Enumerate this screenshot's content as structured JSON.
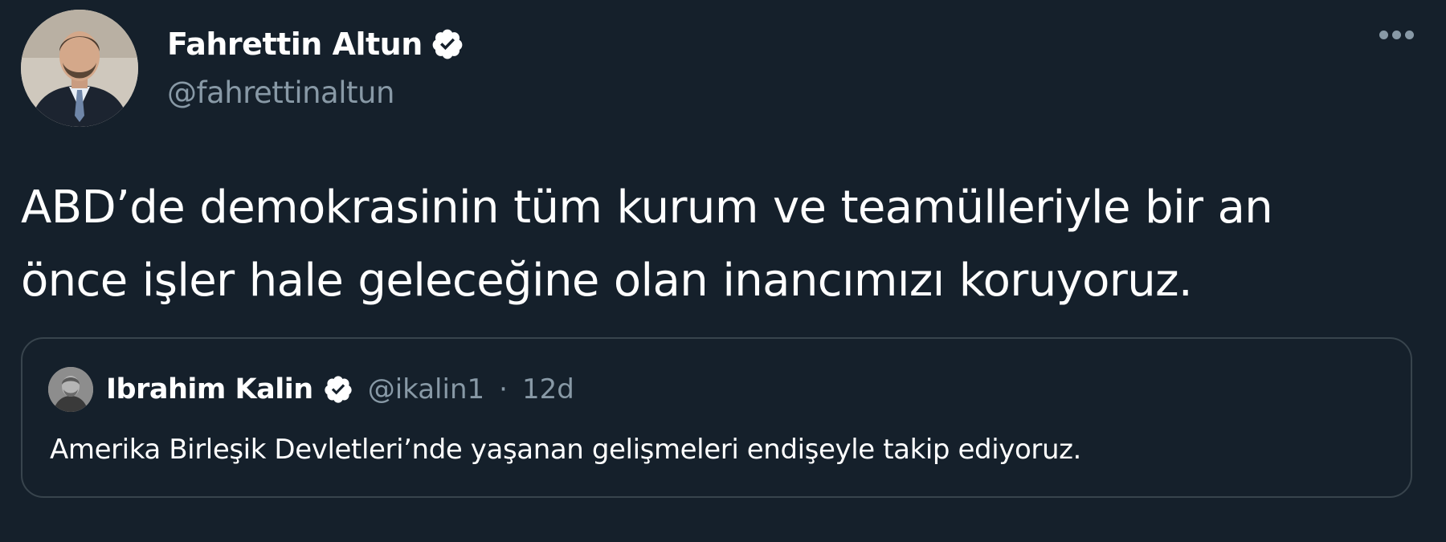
{
  "tweet": {
    "author_name": "Fahrettin Altun",
    "author_handle": "@fahrettinaltun",
    "author_verified": true,
    "text_line_1": "ABD’de demokrasinin tüm kurum ve teamülleriyle bir an",
    "text_line_2": "önce işler hale geleceğine olan inancımızı koruyoruz."
  },
  "quoted_tweet": {
    "author_name": "Ibrahim Kalin",
    "author_handle": "@ikalin1",
    "separator": "·",
    "age": "12d",
    "author_verified": true,
    "text": "Amerika Birleşik Devletleri’nde yaşanan gelişmeleri endişeyle takip ediyoruz."
  },
  "icons": {
    "verified": "verified-badge-icon",
    "more": "more-options-icon"
  },
  "colors": {
    "background": "#15202b",
    "text_primary": "#ffffff",
    "text_secondary": "#8899a6",
    "border": "#38444d"
  }
}
